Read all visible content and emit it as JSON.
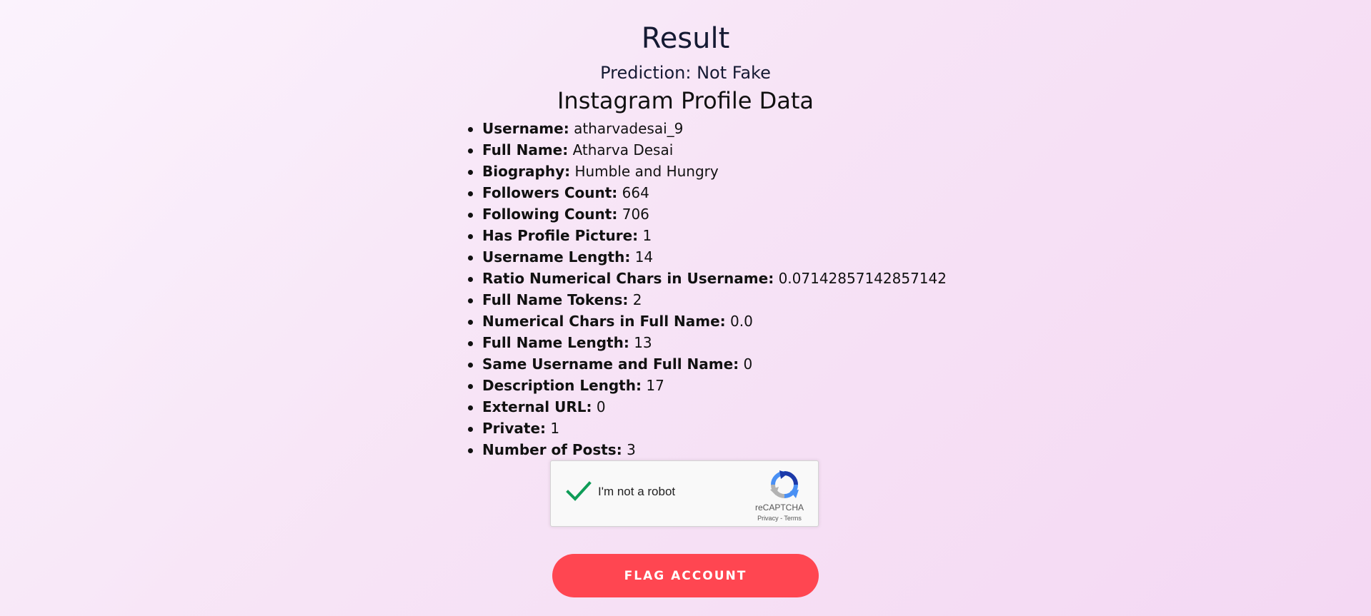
{
  "result": {
    "title": "Result",
    "prediction": "Prediction: Not Fake",
    "section_title": "Instagram Profile Data"
  },
  "profile_fields": [
    {
      "label": "Username:",
      "value": "atharvadesai_9"
    },
    {
      "label": "Full Name:",
      "value": "Atharva Desai"
    },
    {
      "label": "Biography:",
      "value": "Humble and Hungry"
    },
    {
      "label": "Followers Count:",
      "value": "664"
    },
    {
      "label": "Following Count:",
      "value": "706"
    },
    {
      "label": "Has Profile Picture:",
      "value": "1"
    },
    {
      "label": "Username Length:",
      "value": "14"
    },
    {
      "label": "Ratio Numerical Chars in Username:",
      "value": "0.07142857142857142"
    },
    {
      "label": "Full Name Tokens:",
      "value": "2"
    },
    {
      "label": "Numerical Chars in Full Name:",
      "value": "0.0"
    },
    {
      "label": "Full Name Length:",
      "value": "13"
    },
    {
      "label": "Same Username and Full Name:",
      "value": "0"
    },
    {
      "label": "Description Length:",
      "value": "17"
    },
    {
      "label": "External URL:",
      "value": "0"
    },
    {
      "label": "Private:",
      "value": "1"
    },
    {
      "label": "Number of Posts:",
      "value": "3"
    }
  ],
  "captcha": {
    "label": "I'm not a robot",
    "checked": true,
    "brand": "reCAPTCHA",
    "privacy": "Privacy",
    "separator": " - ",
    "terms": "Terms",
    "check_icon": "checkmark-icon",
    "logo_icon": "recaptcha-logo-icon",
    "check_color": "#0f9d58"
  },
  "actions": {
    "flag_label": "FLAG ACCOUNT",
    "flag_color": "#ff4651"
  }
}
